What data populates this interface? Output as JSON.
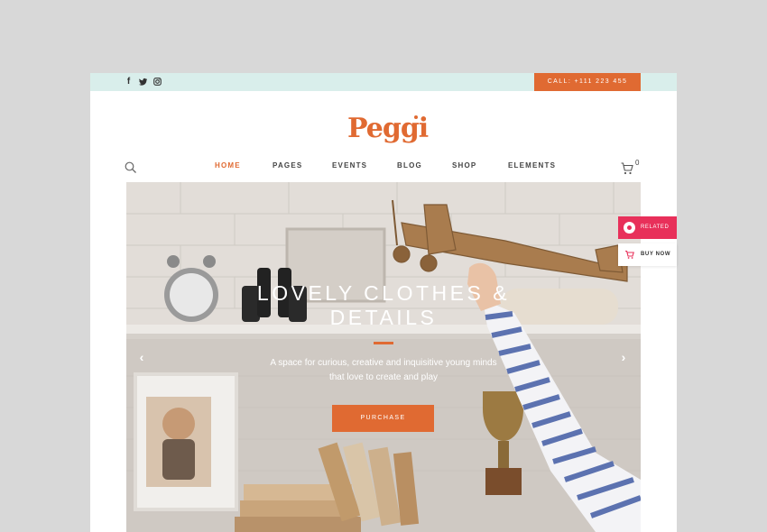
{
  "topbar": {
    "social_icons": [
      "facebook-icon",
      "twitter-icon",
      "instagram-icon"
    ],
    "call_label": "CALL: +111 223 455"
  },
  "logo": {
    "text": "Peggi"
  },
  "nav": {
    "items": [
      {
        "label": "HOME",
        "active": true
      },
      {
        "label": "PAGES"
      },
      {
        "label": "EVENTS"
      },
      {
        "label": "BLOG"
      },
      {
        "label": "SHOP"
      },
      {
        "label": "ELEMENTS"
      }
    ],
    "cart_count": "0"
  },
  "hero": {
    "title": "LOVELY CLOTHES & DETAILS",
    "subtitle": "A space for curious, creative and inquisitive young minds that love to create and play",
    "button_label": "PURCHASE"
  },
  "side": {
    "related_label": "RELATED",
    "buy_label": "BUY NOW"
  },
  "colors": {
    "accent": "#e06a32",
    "topbar_bg": "#d9eeeb",
    "related_bg": "#e8305a"
  }
}
